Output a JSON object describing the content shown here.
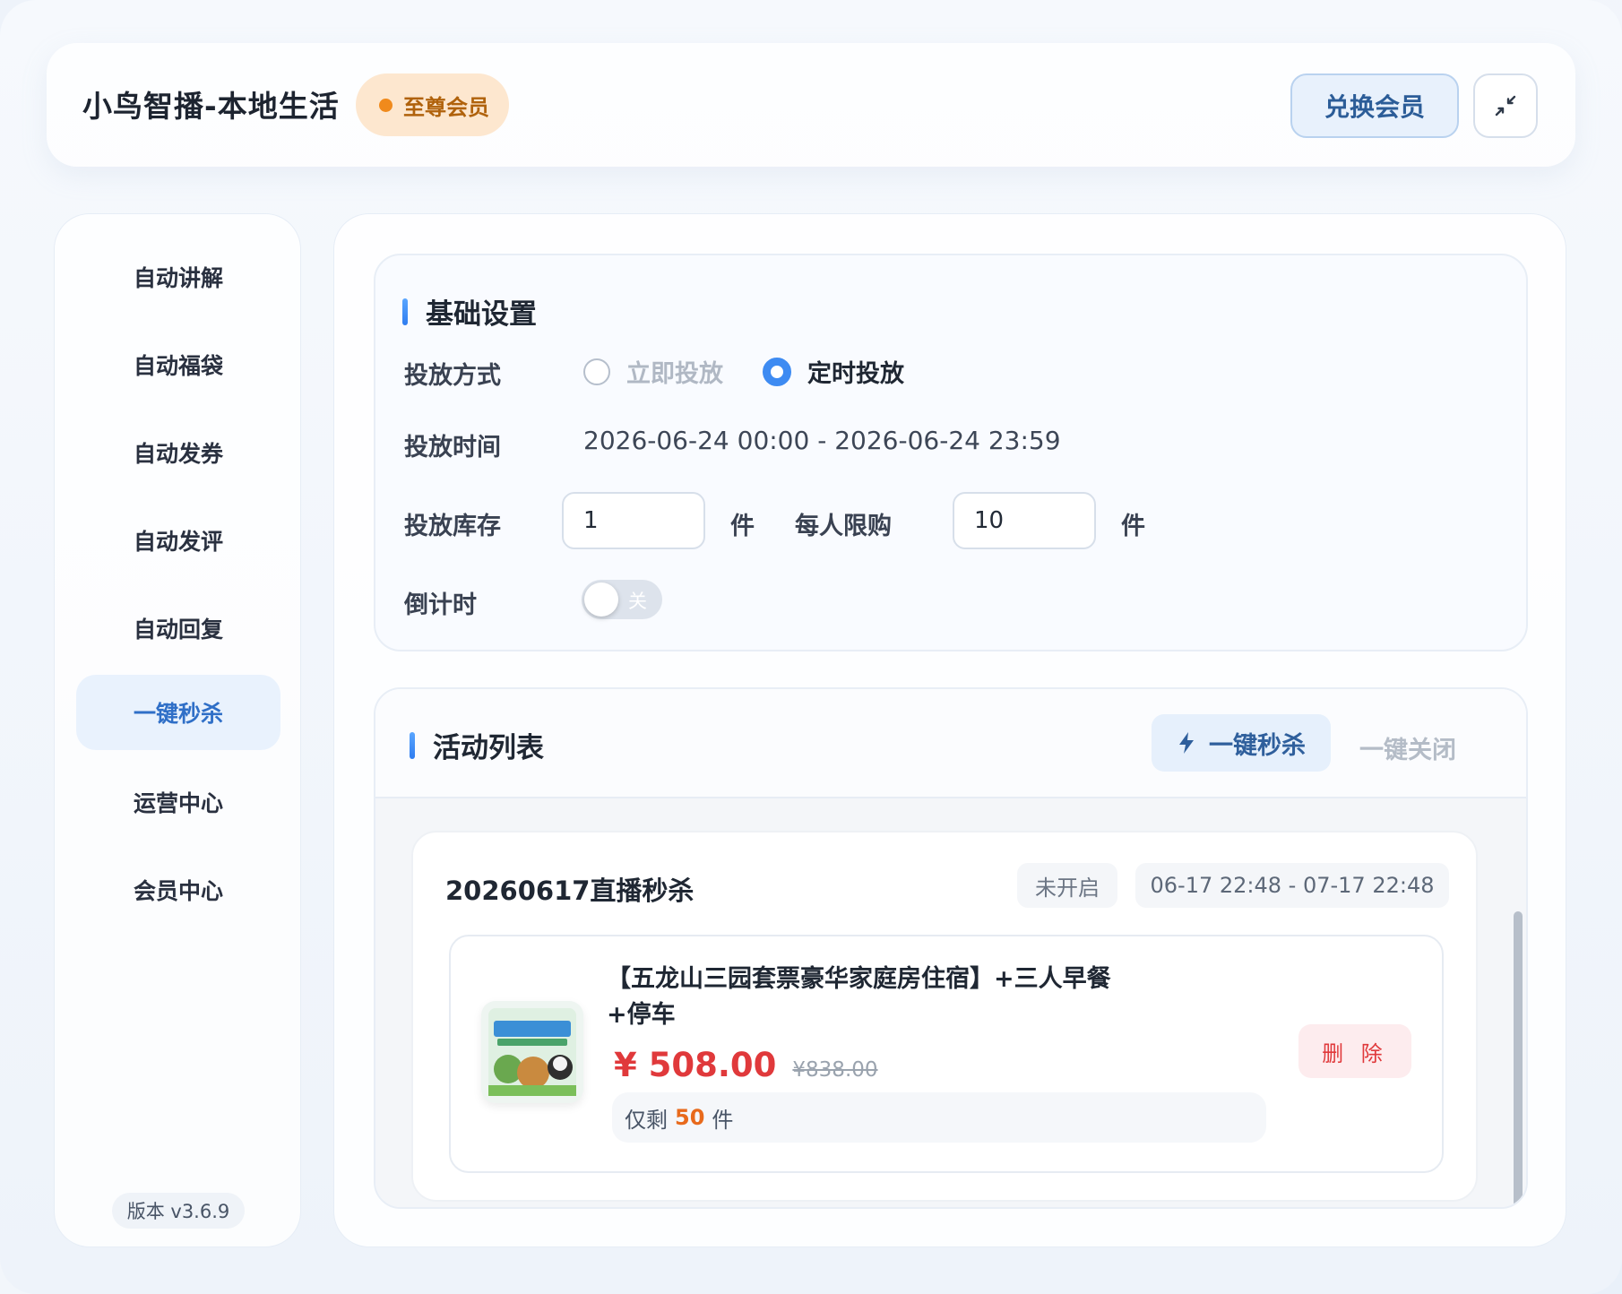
{
  "header": {
    "title": "小鸟智播-本地生活",
    "vip_badge": "至尊会员",
    "redeem_button": "兑换会员",
    "shrink_icon": "shrink-arrows-icon"
  },
  "sidebar": {
    "items": [
      {
        "label": "自动讲解",
        "active": false
      },
      {
        "label": "自动福袋",
        "active": false
      },
      {
        "label": "自动发券",
        "active": false
      },
      {
        "label": "自动发评",
        "active": false
      },
      {
        "label": "自动回复",
        "active": false
      },
      {
        "label": "一键秒杀",
        "active": true
      },
      {
        "label": "运营中心",
        "active": false
      },
      {
        "label": "会员中心",
        "active": false
      }
    ],
    "version": "版本 v3.6.9"
  },
  "basic_settings": {
    "title": "基础设置",
    "delivery_mode": {
      "label": "投放方式",
      "options": [
        "立即投放",
        "定时投放"
      ],
      "selected": "定时投放"
    },
    "delivery_time": {
      "label": "投放时间",
      "value": "2026-06-24 00:00 - 2026-06-24 23:59"
    },
    "stock": {
      "label": "投放库存",
      "value": "1",
      "unit": "件",
      "limit_label": "每人限购",
      "limit_value": "10",
      "limit_unit": "件"
    },
    "countdown": {
      "label": "倒计时",
      "state": "关",
      "enabled": false
    }
  },
  "activity_list": {
    "title": "活动列表",
    "flash_button": "一键秒杀",
    "close_all_button": "一键关闭",
    "activities": [
      {
        "name": "20260617直播秒杀",
        "status": "未开启",
        "time": "06-17 22:48 - 07-17 22:48",
        "product": {
          "name": "【五龙山三园套票豪华家庭房住宿】+三人早餐+停车",
          "price": "¥ 508.00",
          "original_price": "¥838.00",
          "stock_prefix": "仅剩",
          "stock_count": "50",
          "stock_suffix": "件",
          "delete_button": "删 除"
        }
      }
    ]
  },
  "colors": {
    "accent": "#3e8bf2",
    "price": "#e0393b",
    "vip": "#f08a1c"
  }
}
